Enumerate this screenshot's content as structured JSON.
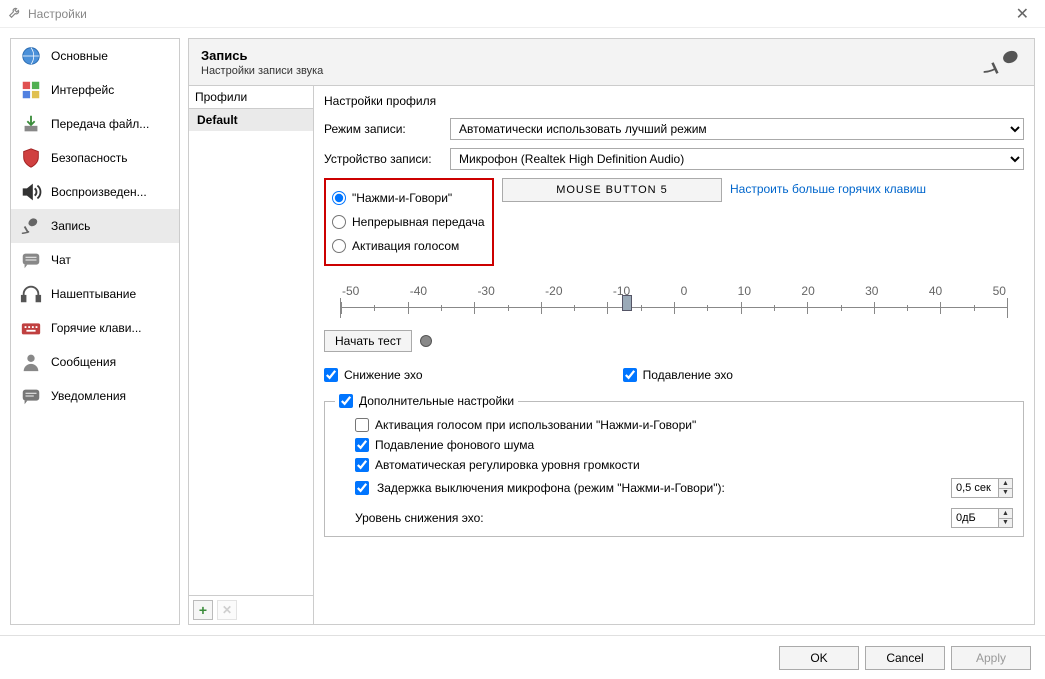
{
  "window": {
    "title": "Настройки"
  },
  "sidebar": {
    "items": [
      {
        "label": "Основные"
      },
      {
        "label": "Интерфейс"
      },
      {
        "label": "Передача файл..."
      },
      {
        "label": "Безопасность"
      },
      {
        "label": "Воспроизведен..."
      },
      {
        "label": "Запись"
      },
      {
        "label": "Чат"
      },
      {
        "label": "Нашептывание"
      },
      {
        "label": "Горячие клави..."
      },
      {
        "label": "Сообщения"
      },
      {
        "label": "Уведомления"
      }
    ]
  },
  "header": {
    "title": "Запись",
    "subtitle": "Настройки записи звука"
  },
  "profiles": {
    "heading": "Профили",
    "default": "Default"
  },
  "settings": {
    "heading": "Настройки профиля",
    "mode_label": "Режим записи:",
    "mode_value": "Автоматически использовать лучший режим",
    "device_label": "Устройство записи:",
    "device_value": "Микрофон (Realtek High Definition Audio)",
    "radio_ptt": "\"Нажми-и-Говори\"",
    "radio_cont": "Непрерывная передача",
    "radio_vad": "Активация голосом",
    "hotkey": "MOUSE BUTTON 5",
    "more_hotkeys": "Настроить больше горячих клавиш",
    "slider_ticks": [
      "-50",
      "-40",
      "-30",
      "-20",
      "-10",
      "0",
      "10",
      "20",
      "30",
      "40",
      "50"
    ],
    "test_btn": "Начать тест",
    "echo_reduce": "Снижение эхо",
    "echo_cancel": "Подавление эхо",
    "advanced": "Дополнительные настройки",
    "adv_vad_ptt": "Активация голосом при использовании \"Нажми-и-Говори\"",
    "adv_noise": "Подавление фонового шума",
    "adv_agc": "Автоматическая регулировка уровня громкости",
    "adv_delay": "Задержка выключения микрофона (режим \"Нажми-и-Говори\"):",
    "adv_delay_val": "0,5 сек",
    "adv_level": "Уровень снижения эхо:",
    "adv_level_val": "0дБ"
  },
  "footer": {
    "ok": "OK",
    "cancel": "Cancel",
    "apply": "Apply"
  }
}
